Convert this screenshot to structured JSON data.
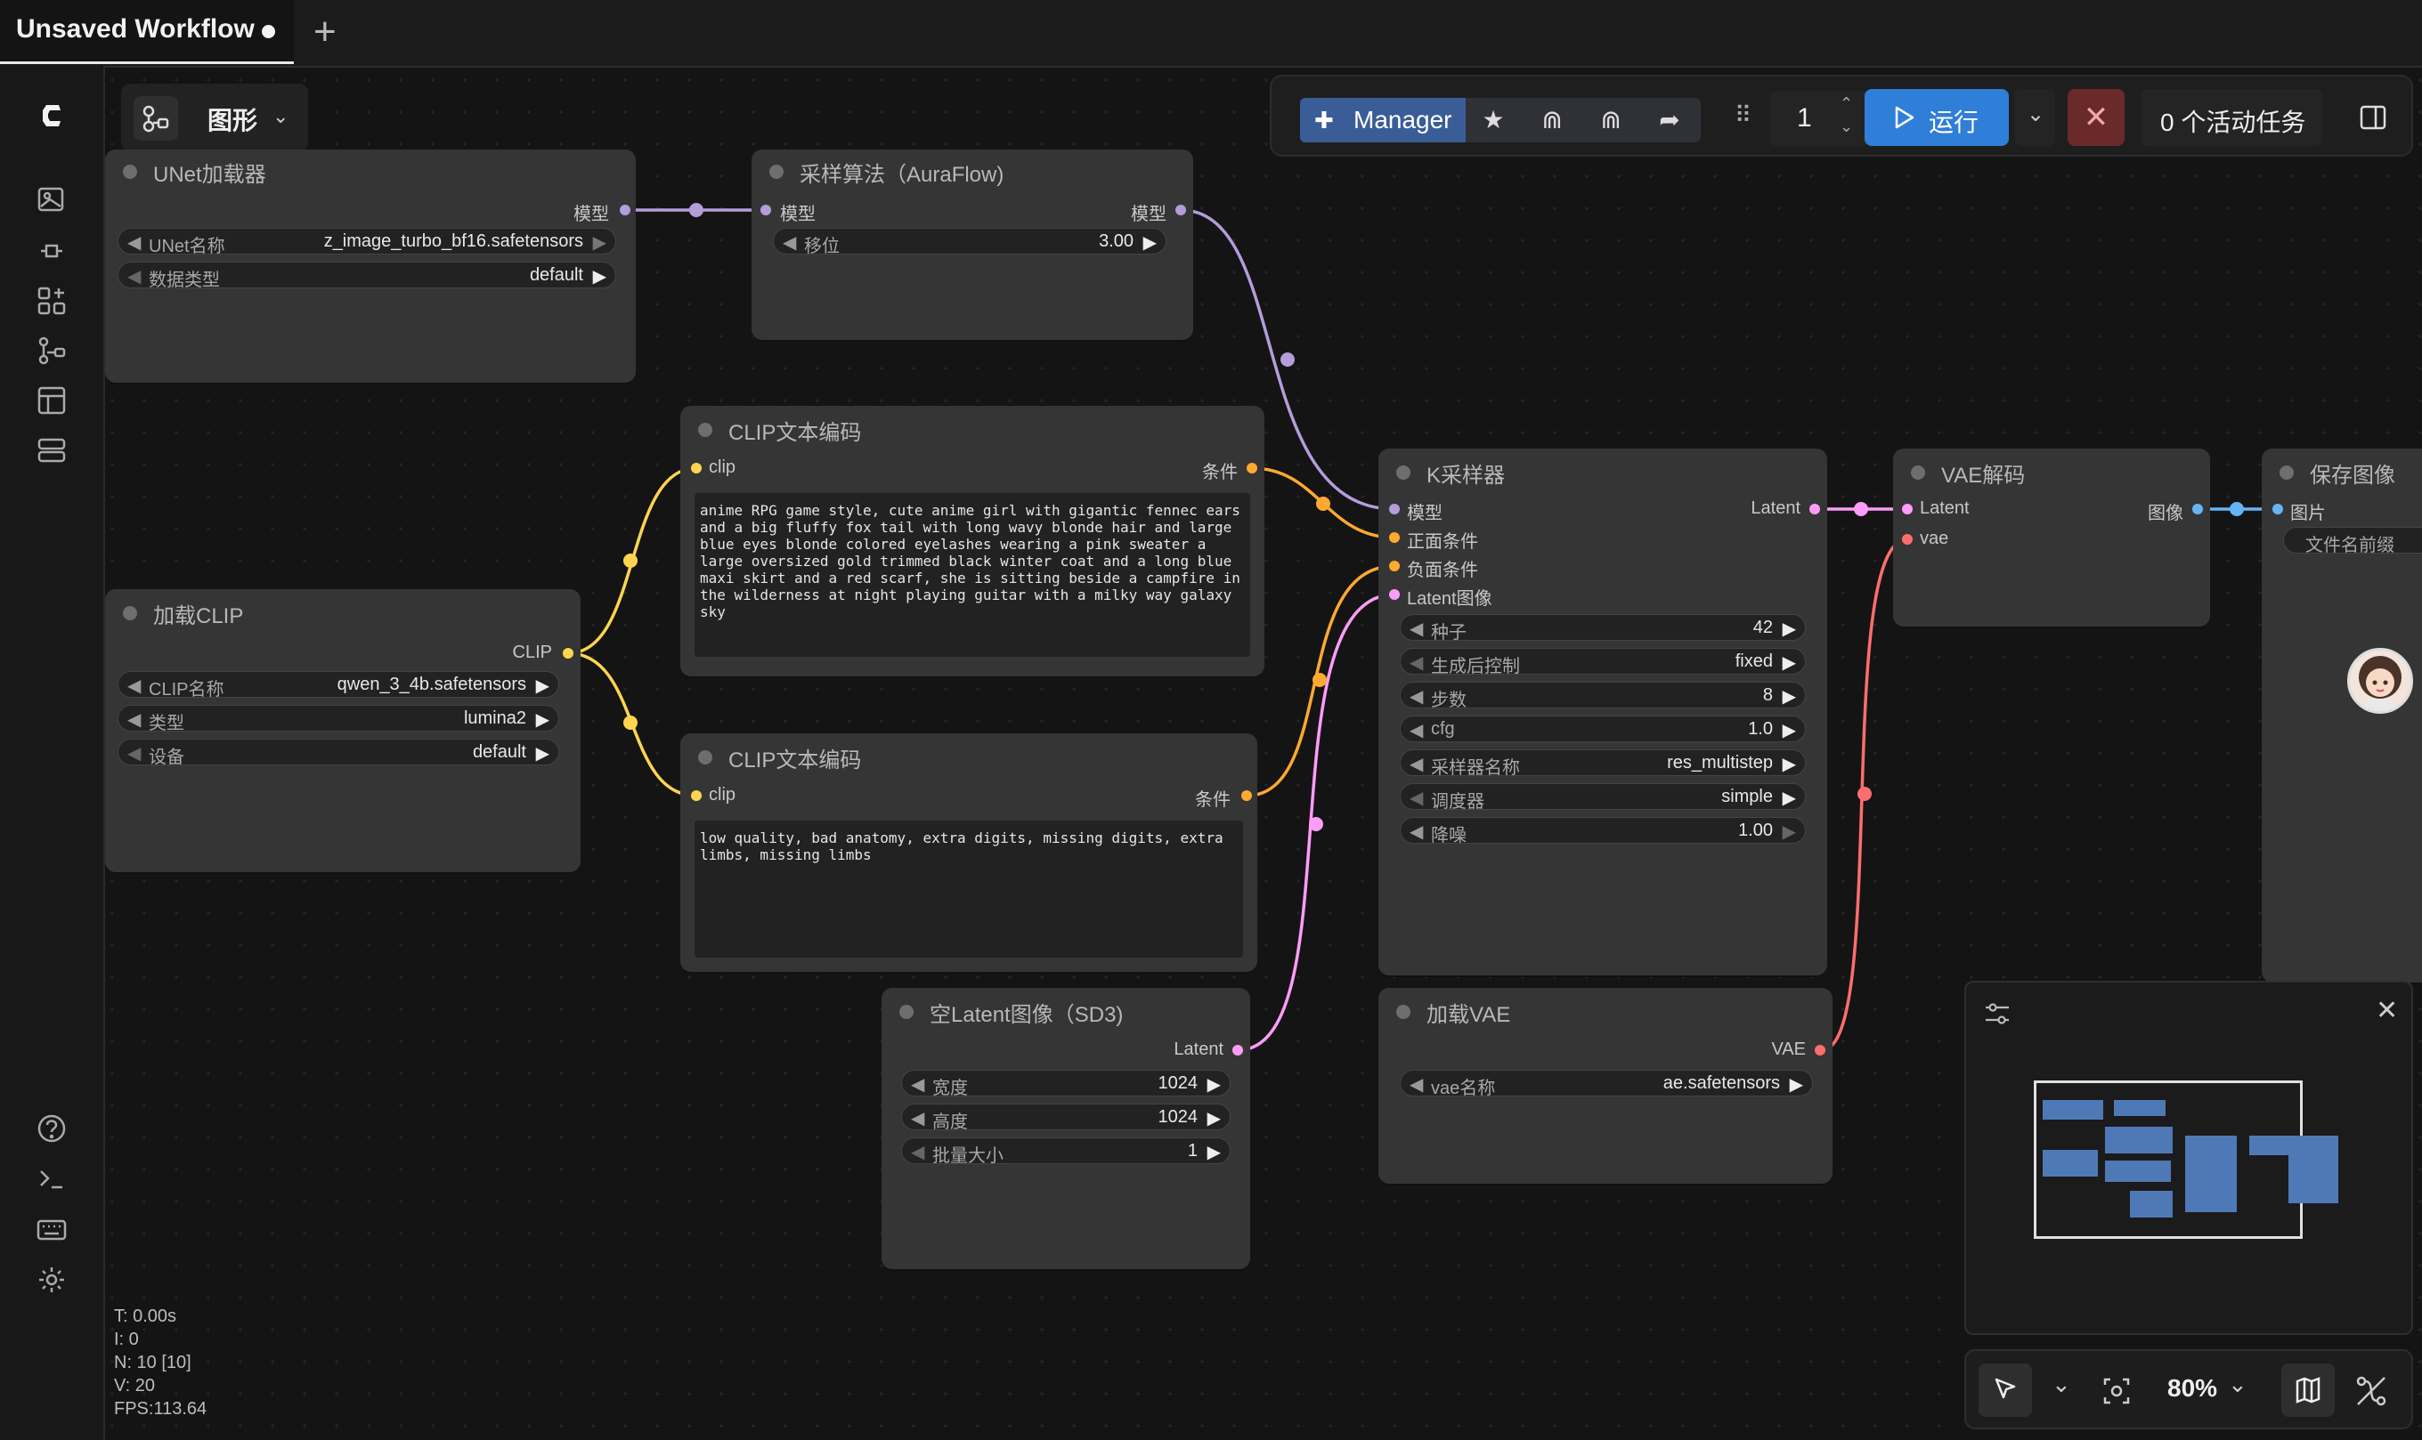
{
  "tab": {
    "title": "Unsaved Workflow"
  },
  "graph_toggle": {
    "label": "图形"
  },
  "toolbar": {
    "manager_label": "Manager",
    "queue_count": "1",
    "run_label": "运行",
    "tasks_label": "0 个活动任务"
  },
  "nodes": {
    "unet": {
      "title": "UNet加载器",
      "out_model": "模型",
      "w1_label": "UNet名称",
      "w1_value": "z_image_turbo_bf16.safetensors",
      "w2_label": "数据类型",
      "w2_value": "default"
    },
    "sampling": {
      "title": "采样算法（AuraFlow)",
      "in_model": "模型",
      "out_model": "模型",
      "w1_label": "移位",
      "w1_value": "3.00"
    },
    "clip_pos": {
      "title": "CLIP文本编码",
      "in_clip": "clip",
      "out_cond": "条件",
      "text": "anime RPG game style, cute anime girl with gigantic fennec ears and a big fluffy fox tail with long wavy blonde hair and large blue eyes blonde colored eyelashes wearing a pink sweater a large oversized gold trimmed black winter coat and a long blue maxi skirt and a red scarf, she is sitting beside a campfire in the wilderness at night playing guitar with a milky way galaxy sky"
    },
    "clip_neg": {
      "title": "CLIP文本编码",
      "in_clip": "clip",
      "out_cond": "条件",
      "text": "low quality, bad anatomy, extra digits, missing digits, extra limbs, missing limbs"
    },
    "load_clip": {
      "title": "加载CLIP",
      "out_clip": "CLIP",
      "w1_label": "CLIP名称",
      "w1_value": "qwen_3_4b.safetensors",
      "w2_label": "类型",
      "w2_value": "lumina2",
      "w3_label": "设备",
      "w3_value": "default"
    },
    "ksampler": {
      "title": "K采样器",
      "in_model": "模型",
      "in_pos": "正面条件",
      "in_neg": "负面条件",
      "in_latent": "Latent图像",
      "out_latent": "Latent",
      "widgets": [
        {
          "label": "种子",
          "value": "42"
        },
        {
          "label": "生成后控制",
          "value": "fixed"
        },
        {
          "label": "步数",
          "value": "8"
        },
        {
          "label": "cfg",
          "value": "1.0"
        },
        {
          "label": "采样器名称",
          "value": "res_multistep"
        },
        {
          "label": "调度器",
          "value": "simple"
        },
        {
          "label": "降噪",
          "value": "1.00"
        }
      ]
    },
    "vae_decode": {
      "title": "VAE解码",
      "in_latent": "Latent",
      "in_vae": "vae",
      "out_image": "图像"
    },
    "save_image": {
      "title": "保存图像",
      "in_images": "图片",
      "w1_label": "文件名前缀"
    },
    "empty_latent": {
      "title": "空Latent图像（SD3)",
      "out_latent": "Latent",
      "w1_label": "宽度",
      "w1_value": "1024",
      "w2_label": "高度",
      "w2_value": "1024",
      "w3_label": "批量大小",
      "w3_value": "1"
    },
    "load_vae": {
      "title": "加载VAE",
      "out_vae": "VAE",
      "w1_label": "vae名称",
      "w1_value": "ae.safetensors"
    }
  },
  "stats": {
    "t": "T: 0.00s",
    "i": "I: 0",
    "n": "N: 10 [10]",
    "v": "V: 20",
    "fps": "FPS:113.64"
  },
  "zoom": {
    "level": "80%"
  },
  "colors": {
    "model": "#b39ddb",
    "clip": "#ffd54f",
    "conditioning": "#ffa931",
    "latent": "#ff9cf9",
    "vae": "#ff6e6e",
    "image": "#64b5f6",
    "run": "#2f7ed8"
  }
}
